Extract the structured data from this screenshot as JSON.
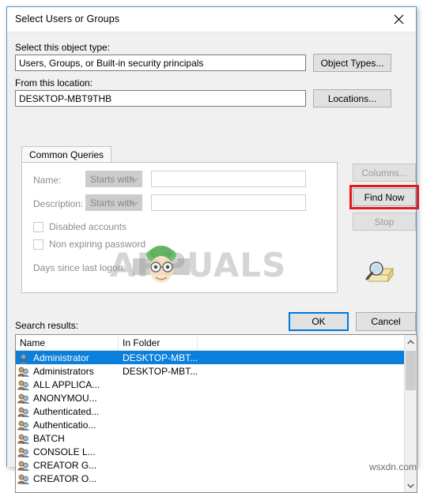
{
  "window": {
    "title": "Select Users or Groups",
    "close_icon": "close-icon"
  },
  "object_type": {
    "label": "Select this object type:",
    "value": "Users, Groups, or Built-in security principals",
    "button": "Object Types..."
  },
  "location": {
    "label": "From this location:",
    "value": "DESKTOP-MBT9THB",
    "button": "Locations..."
  },
  "tabs": [
    {
      "label": "Common Queries",
      "active": true
    }
  ],
  "common_queries": {
    "name": {
      "label": "Name:",
      "operator": "Starts with",
      "value": "",
      "placeholder": ""
    },
    "description": {
      "label": "Description:",
      "operator": "Starts with",
      "value": "",
      "placeholder": ""
    },
    "disabled_accounts": {
      "label": "Disabled accounts",
      "checked": false
    },
    "non_expiring_password": {
      "label": "Non expiring password",
      "checked": false
    },
    "days_since_last_logon": {
      "label": "Days since last logon:",
      "value": ""
    }
  },
  "side_buttons": {
    "columns": "Columns...",
    "find_now": "Find Now",
    "stop": "Stop",
    "search_icon": "magnifier-folder-icon"
  },
  "dialog_buttons": {
    "ok": "OK",
    "cancel": "Cancel"
  },
  "search_results": {
    "label": "Search results:",
    "columns": [
      "Name",
      "In Folder"
    ],
    "rows": [
      {
        "name": "Administrator",
        "folder": "DESKTOP-MBT...",
        "icon": "user-icon",
        "selected": true
      },
      {
        "name": "Administrators",
        "folder": "DESKTOP-MBT...",
        "icon": "group-icon",
        "selected": false
      },
      {
        "name": "ALL APPLICA...",
        "folder": "",
        "icon": "group-icon",
        "selected": false
      },
      {
        "name": "ANONYMOU...",
        "folder": "",
        "icon": "group-icon",
        "selected": false
      },
      {
        "name": "Authenticated...",
        "folder": "",
        "icon": "group-icon",
        "selected": false
      },
      {
        "name": "Authenticatio...",
        "folder": "",
        "icon": "group-icon",
        "selected": false
      },
      {
        "name": "BATCH",
        "folder": "",
        "icon": "group-icon",
        "selected": false
      },
      {
        "name": "CONSOLE L...",
        "folder": "",
        "icon": "group-icon",
        "selected": false
      },
      {
        "name": "CREATOR G...",
        "folder": "",
        "icon": "group-icon",
        "selected": false
      },
      {
        "name": "CREATOR O...",
        "folder": "",
        "icon": "group-icon",
        "selected": false
      }
    ]
  },
  "watermarks": {
    "center": "APPUALS",
    "bottom_right": "wsxdn.com"
  },
  "colors": {
    "selection_blue": "#0a7fdb",
    "window_border": "#4a9bd4",
    "annotation_red": "#e31b1b",
    "default_button_focus": "#0078d7",
    "dialog_background": "#f0f0f0",
    "disabled_text": "#8c8c8c"
  }
}
